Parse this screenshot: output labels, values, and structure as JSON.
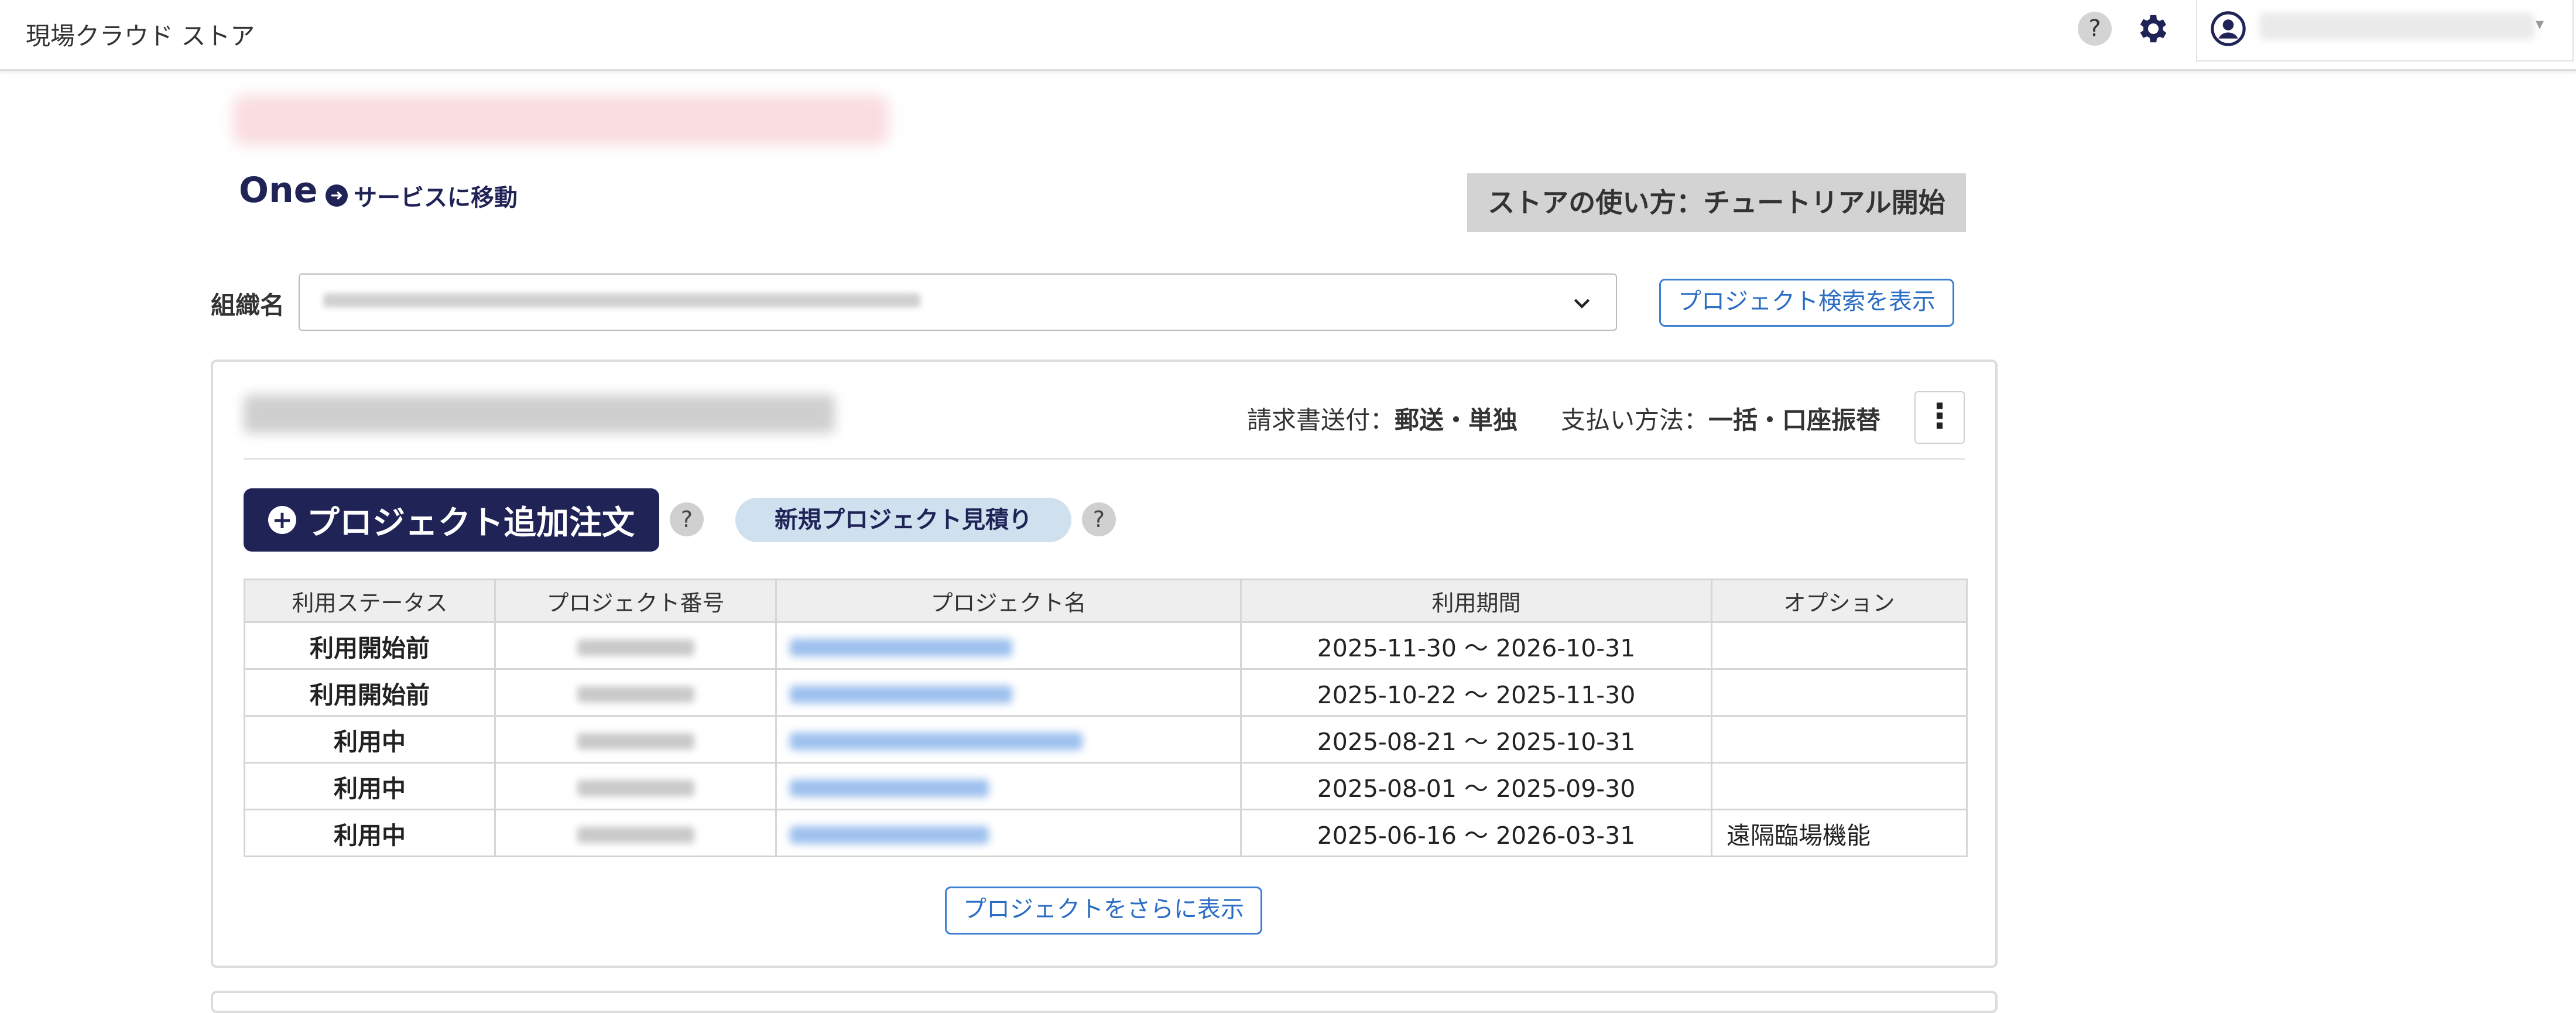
{
  "app": {
    "title": "現場クラウド ストア"
  },
  "header": {
    "help_icon_text": "?",
    "gear_icon": "gear-icon",
    "avatar_icon": "user-circle-icon",
    "caret": "▾"
  },
  "service": {
    "name": "One",
    "go_label": "サービスに移動",
    "tutorial_label": "ストアの使い方：チュートリアル開始"
  },
  "org": {
    "label": "組織名",
    "search_button": "プロジェクト検索を表示"
  },
  "card": {
    "billing_label": "請求書送付：",
    "billing_value": "郵送・単独",
    "payment_label": "支払い方法：",
    "payment_value": "一括・口座振替",
    "kebab": "⋮",
    "add_order_label": "プロジェクト追加注文",
    "help_text": "?",
    "estimate_label": "新規プロジェクト見積り",
    "more_button": "プロジェクトをさらに表示"
  },
  "table": {
    "headers": [
      "利用ステータス",
      "プロジェクト番号",
      "プロジェクト名",
      "利用期間",
      "オプション"
    ],
    "rows": [
      {
        "status": "利用開始前",
        "period": "2025-11-30 〜 2026-10-31",
        "option": ""
      },
      {
        "status": "利用開始前",
        "period": "2025-10-22 〜 2025-11-30",
        "option": ""
      },
      {
        "status": "利用中",
        "period": "2025-08-21 〜 2025-10-31",
        "option": ""
      },
      {
        "status": "利用中",
        "period": "2025-08-01 〜 2025-09-30",
        "option": ""
      },
      {
        "status": "利用中",
        "period": "2025-06-16 〜 2026-03-31",
        "option": "遠隔臨場機能"
      }
    ]
  },
  "colors": {
    "brand_navy": "#1f2356",
    "link_blue": "#2b6cc4",
    "estimate_bg": "#cfe0ef",
    "tutorial_bg": "#d3d3d3"
  }
}
